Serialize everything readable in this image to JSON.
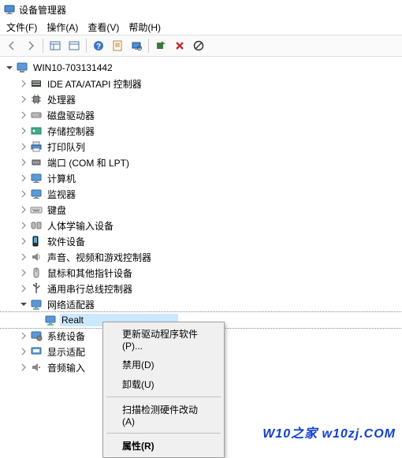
{
  "title": "设备管理器",
  "menu": {
    "file": "文件(F)",
    "action": "操作(A)",
    "view": "查看(V)",
    "help": "帮助(H)"
  },
  "root": "WIN10-703131442",
  "nodes": [
    {
      "label": "IDE ATA/ATAPI 控制器"
    },
    {
      "label": "处理器"
    },
    {
      "label": "磁盘驱动器"
    },
    {
      "label": "存储控制器"
    },
    {
      "label": "打印队列"
    },
    {
      "label": "端口 (COM 和 LPT)"
    },
    {
      "label": "计算机"
    },
    {
      "label": "监视器"
    },
    {
      "label": "键盘"
    },
    {
      "label": "人体学输入设备"
    },
    {
      "label": "软件设备"
    },
    {
      "label": "声音、视频和游戏控制器"
    },
    {
      "label": "鼠标和其他指针设备"
    },
    {
      "label": "通用串行总线控制器"
    },
    {
      "label": "网络适配器",
      "expanded": true,
      "children": [
        {
          "label": "Realt"
        }
      ]
    },
    {
      "label": "系统设备"
    },
    {
      "label": "显示适配"
    },
    {
      "label": "音频输入"
    }
  ],
  "context": {
    "update": "更新驱动程序软件(P)...",
    "disable": "禁用(D)",
    "uninstall": "卸载(U)",
    "scan": "扫描检测硬件改动(A)",
    "properties": "属性(R)"
  },
  "footer": "W10之家 w10zj.COM"
}
